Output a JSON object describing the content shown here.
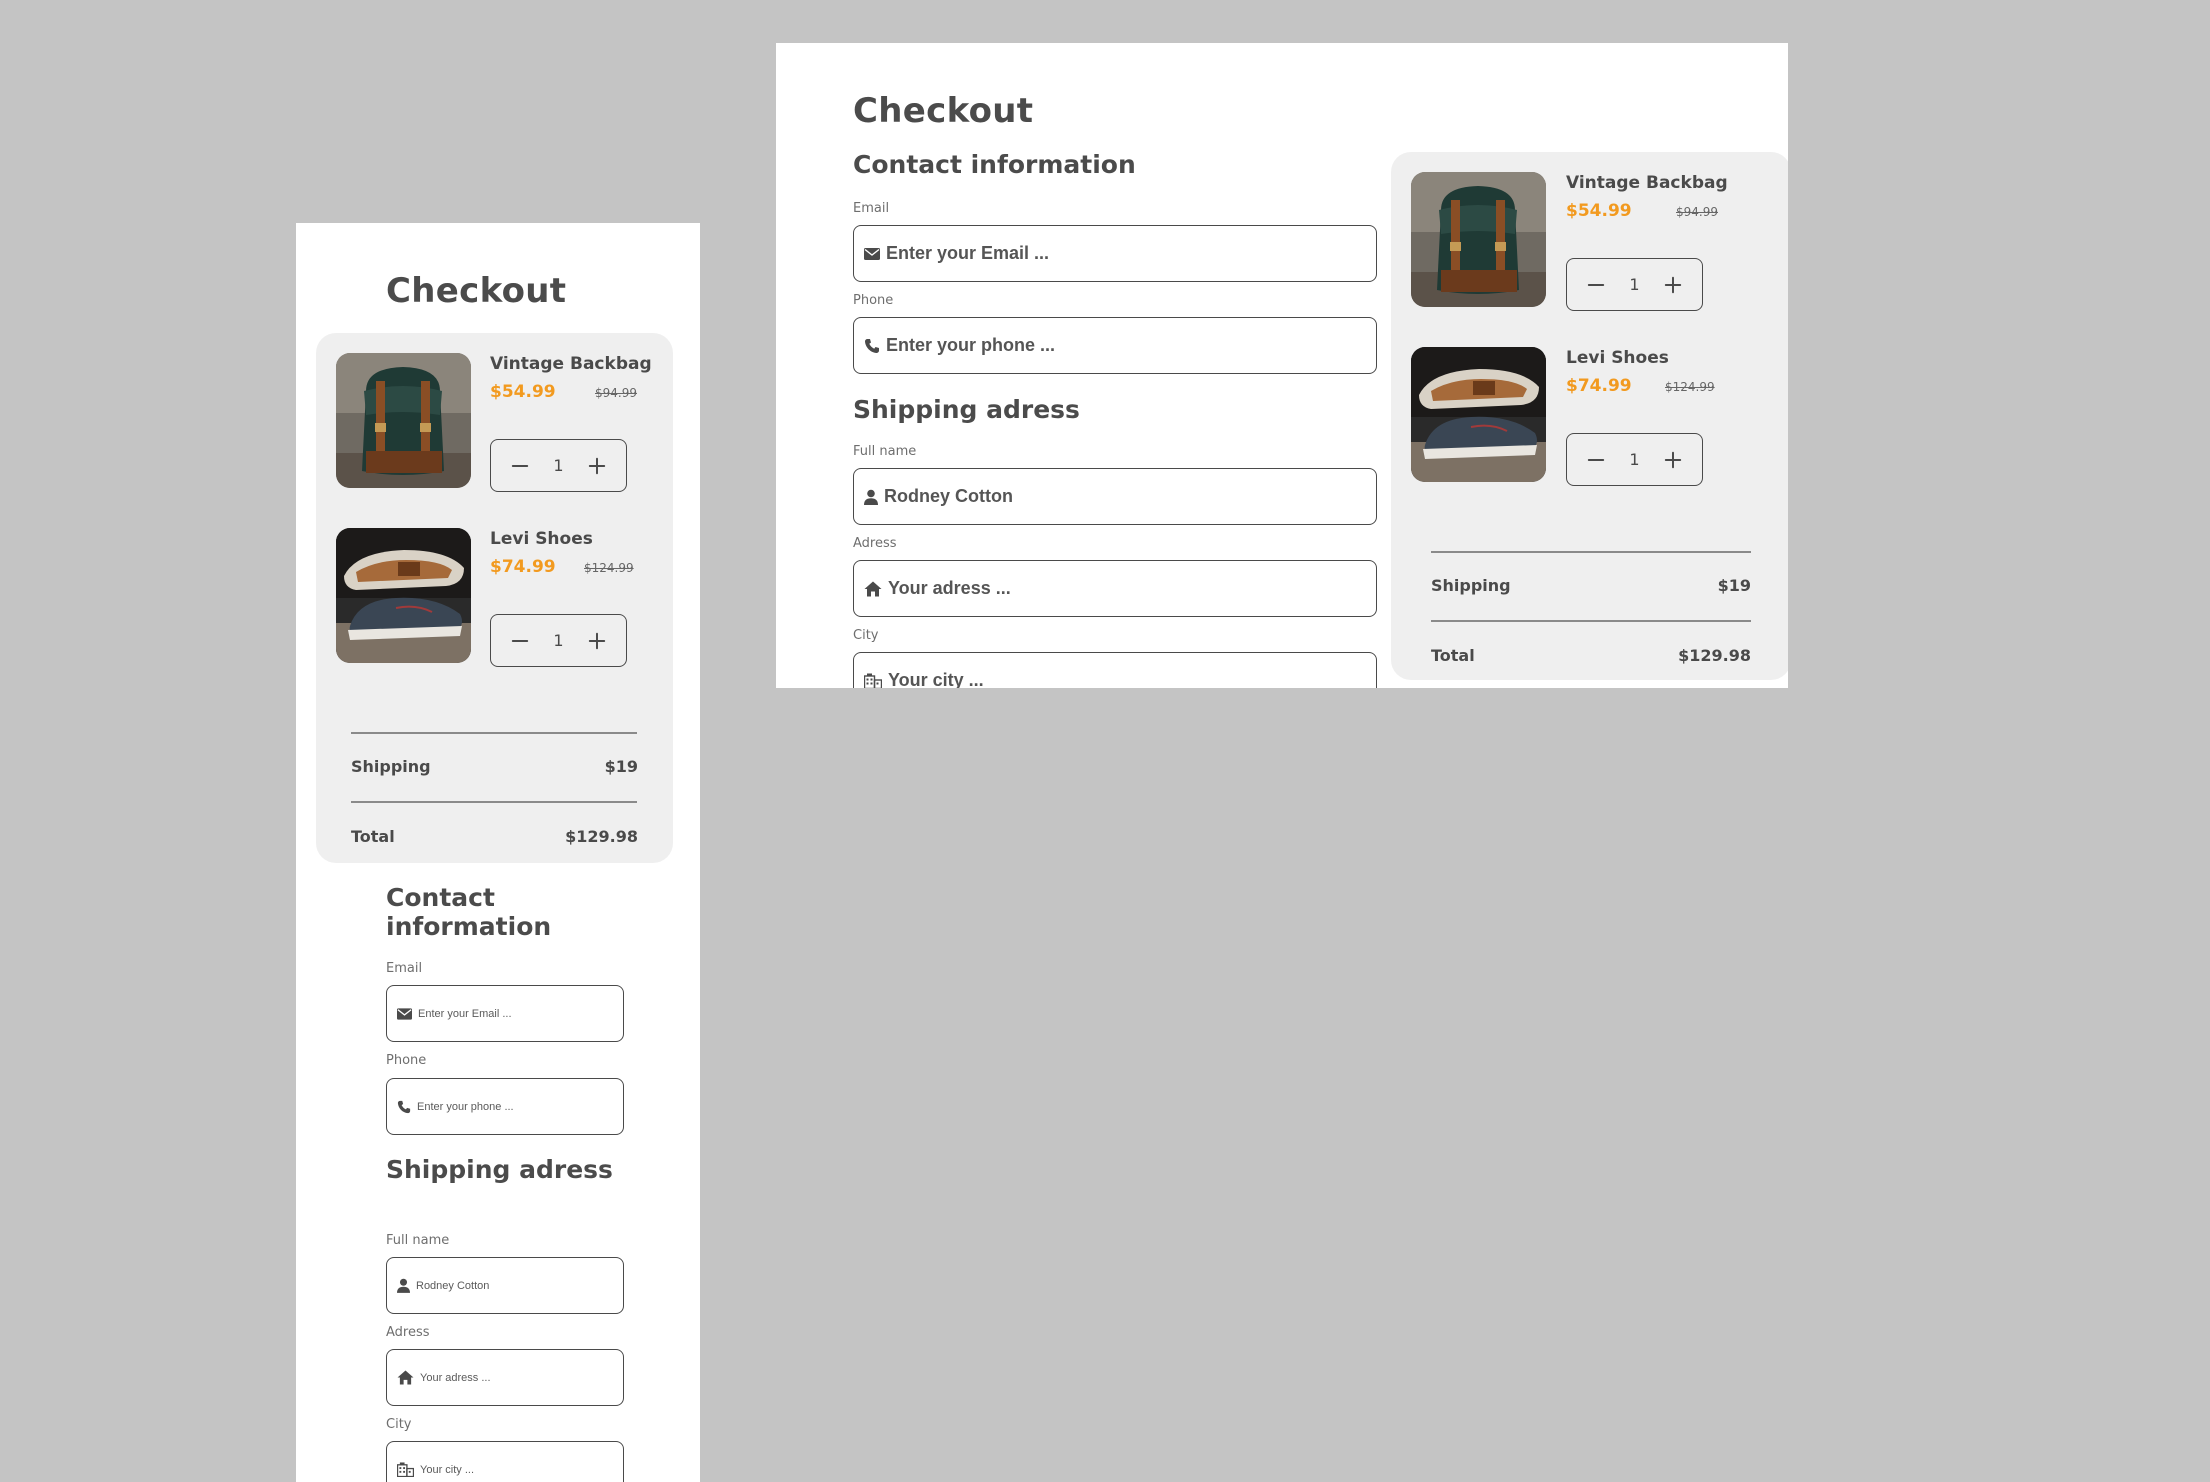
{
  "checkout": {
    "title": "Checkout",
    "contact": {
      "heading": "Contact information",
      "email_label": "Email",
      "email_placeholder": "Enter your Email ...",
      "phone_label": "Phone",
      "phone_placeholder": "Enter your phone ..."
    },
    "shipping_address": {
      "heading": "Shipping adress",
      "fullname_label": "Full name",
      "fullname_value": "Rodney Cotton",
      "address_label": "Adress",
      "address_placeholder": "Your adress ...",
      "city_label": "City",
      "city_placeholder": "Your city ..."
    },
    "cart": {
      "items": [
        {
          "name": "Vintage Backbag",
          "price": "$54.99",
          "old_price": "$94.99",
          "quantity": "1"
        },
        {
          "name": "Levi Shoes",
          "price": "$74.99",
          "old_price": "$124.99",
          "quantity": "1"
        }
      ],
      "shipping_label": "Shipping",
      "shipping_value": "$19",
      "total_label": "Total",
      "total_value": "$129.98"
    }
  },
  "colors": {
    "background": "#c4c4c4",
    "panel": "#ffffff",
    "cart_panel": "#efefef",
    "accent_price": "#f29a1f",
    "text": "#4a4a4a"
  },
  "icons": [
    "envelope-icon",
    "phone-icon",
    "user-icon",
    "home-icon",
    "building-icon",
    "minus-icon",
    "plus-icon"
  ]
}
